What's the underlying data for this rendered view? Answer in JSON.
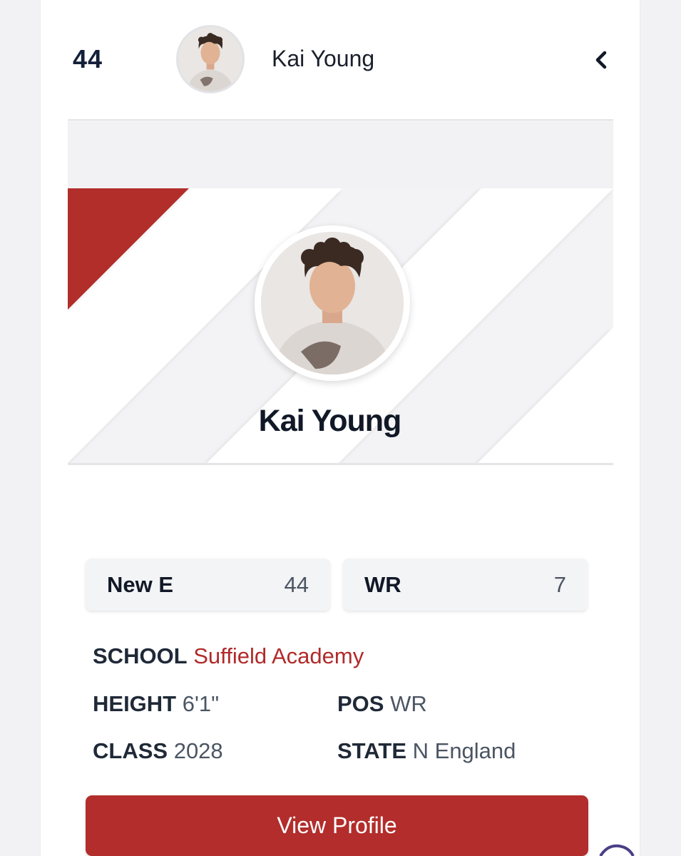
{
  "header": {
    "rank": "44",
    "name": "Kai Young",
    "avatar_icon": "player-photo-icon",
    "collapse_icon": "chevron-left-icon"
  },
  "banner": {
    "name": "Kai Young",
    "accent_color": "#b22d2b"
  },
  "stats": [
    {
      "label": "New E",
      "value": "44"
    },
    {
      "label": "WR",
      "value": "7"
    }
  ],
  "details": {
    "school_label": "SCHOOL",
    "school_value": "Suffield Academy",
    "height_label": "HEIGHT",
    "height_value": "6'1\"",
    "pos_label": "POS",
    "pos_value": "WR",
    "class_label": "CLASS",
    "class_value": "2028",
    "state_label": "STATE",
    "state_value": "N England"
  },
  "button": {
    "label": "View Profile"
  },
  "colors": {
    "brand_red": "#b22d2b",
    "text_dark": "#111827"
  }
}
